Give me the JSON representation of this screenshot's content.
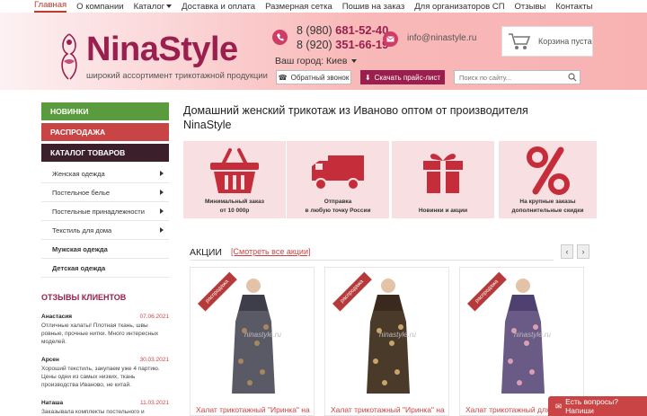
{
  "nav": {
    "items": [
      {
        "label": "Главная",
        "active": true
      },
      {
        "label": "О компании",
        "active": false
      },
      {
        "label": "Каталог",
        "active": false,
        "dropdown": true
      },
      {
        "label": "Доставка и оплата",
        "active": false
      },
      {
        "label": "Размерная сетка",
        "active": false
      },
      {
        "label": "Пошив на заказ",
        "active": false
      },
      {
        "label": "Для организаторов СП",
        "active": false
      },
      {
        "label": "Отзывы",
        "active": false
      },
      {
        "label": "Контакты",
        "active": false
      }
    ]
  },
  "header": {
    "logo_text": "NinaStyle",
    "logo_tagline": "широкий ассортимент трикотажной продукции",
    "phone1_prefix": "8 (980)",
    "phone1_number": "681-52-40",
    "phone2_prefix": "8 (920)",
    "phone2_number": "351-66-19",
    "email": "info@ninastyle.ru",
    "city_label": "Ваш город:",
    "city_value": "Киев",
    "cart_label": "Корзина пуста",
    "callback_label": "Обратный звонок",
    "pricelist_label": "Скачать прайс-лист",
    "search_placeholder": "Поиск по сайту...",
    "accent_color": "#9a1f4e"
  },
  "sidebar": {
    "new_label": "НОВИНКИ",
    "sale_label": "РАСПРОДАЖА",
    "catalog_label": "КАТАЛОГ ТОВАРОВ",
    "items": [
      {
        "label": "Женская одежда",
        "arrow": true
      },
      {
        "label": "Постельное белье",
        "arrow": true
      },
      {
        "label": "Постельные принадлежности",
        "arrow": true
      },
      {
        "label": "Текстиль для дома",
        "arrow": true
      },
      {
        "label": "Мужская одежда",
        "arrow": false
      },
      {
        "label": "Детская одежда",
        "arrow": false
      }
    ]
  },
  "reviews": {
    "title": "ОТЗЫВЫ КЛИЕНТОВ",
    "items": [
      {
        "name": "Анастасия",
        "date": "07.06.2021",
        "text": "Отличные халаты! Плотная ткань, швы ровные, прочные нитки. Много интересных моделей."
      },
      {
        "name": "Арсен",
        "date": "30.03.2021",
        "text": "Хороший текстиль, закупаем уже 4 партию. Цены одни из самых низких, ткань производства Иваново, не китай."
      },
      {
        "name": "Наташа",
        "date": "11.03.2021",
        "text": "Заказывала комплекты постельного и"
      }
    ]
  },
  "main": {
    "title": "Домашний женский трикотаж из Иваново оптом от производителя NinaStyle",
    "features": [
      {
        "icon": "basket-icon",
        "line1": "Минимальный заказ",
        "line2": "от 10 000р"
      },
      {
        "icon": "truck-icon",
        "line1": "Отправка",
        "line2": "в любую точку России"
      },
      {
        "icon": "gift-icon",
        "line1": "Новинки и акции",
        "line2": ""
      },
      {
        "icon": "percent-icon",
        "line1": "На крупные заказы",
        "line2": "дополнительные скидки"
      }
    ],
    "promo_title": "АКЦИИ",
    "promo_link": "[Смотреть все акции]",
    "prev_label": "‹",
    "next_label": "›",
    "products": [
      {
        "ribbon": "распродажа",
        "watermark": "ninastyle.ru",
        "name": "Халат трикотажный \"Иринка\" на"
      },
      {
        "ribbon": "распродажа",
        "watermark": "ninastyle.ru",
        "name": "Халат трикотажный \"Иринка\" на"
      },
      {
        "ribbon": "распродажа",
        "watermark": "ninastyle.ru",
        "name": "Халат трикотажный для бе"
      }
    ]
  },
  "chat": {
    "label": "Есть вопросы? Напиши"
  }
}
